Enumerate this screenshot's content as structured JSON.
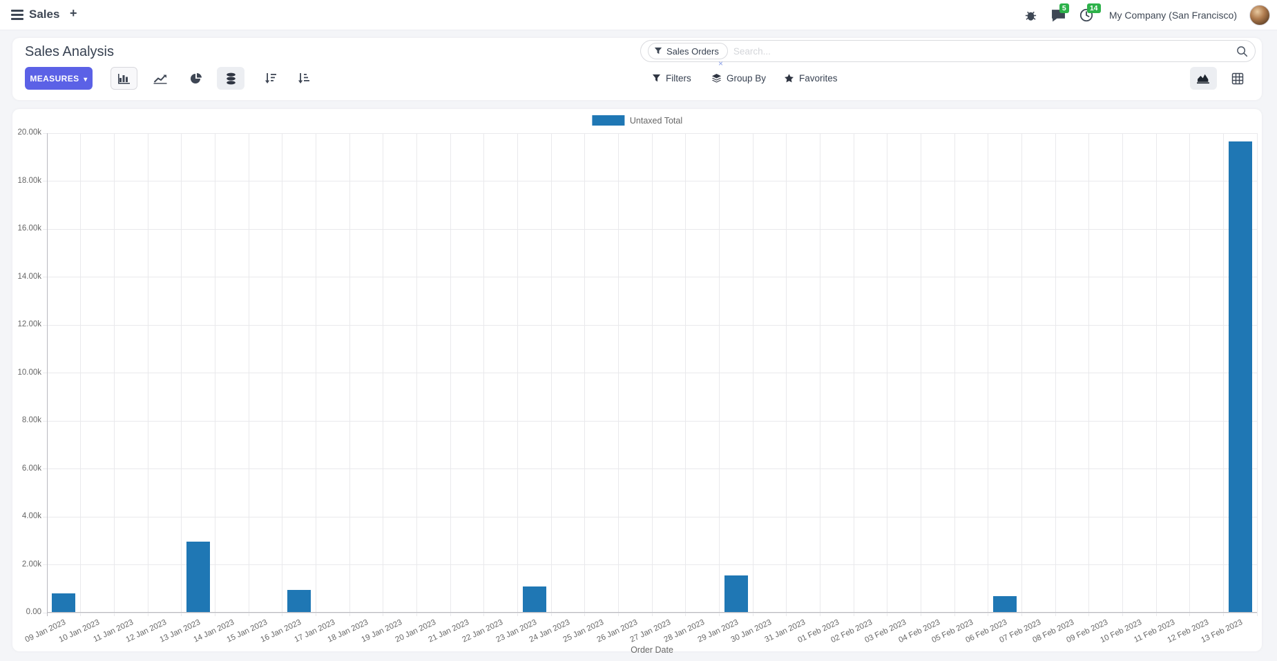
{
  "navbar": {
    "app_name": "Sales",
    "plus_label": "+",
    "messages_badge": "5",
    "activities_badge": "14",
    "company": "My Company (San Francisco)"
  },
  "control_panel": {
    "title": "Sales Analysis",
    "measures_label": "MEASURES",
    "measures_caret": "▾",
    "search": {
      "facet_label": "Sales Orders",
      "facet_remove": "×",
      "placeholder": "Search..."
    },
    "buttons": {
      "filters": "Filters",
      "group_by": "Group By",
      "favorites": "Favorites"
    }
  },
  "colors": {
    "accent": "#5b61e6",
    "badge_green": "#2db24a",
    "bar": "#1f77b4"
  },
  "chart_data": {
    "type": "bar",
    "title": "",
    "legend": [
      "Untaxed Total"
    ],
    "legend_position": "top",
    "series_color": "#1f77b4",
    "categories": [
      "09 Jan 2023",
      "10 Jan 2023",
      "11 Jan 2023",
      "12 Jan 2023",
      "13 Jan 2023",
      "14 Jan 2023",
      "15 Jan 2023",
      "16 Jan 2023",
      "17 Jan 2023",
      "18 Jan 2023",
      "19 Jan 2023",
      "20 Jan 2023",
      "21 Jan 2023",
      "22 Jan 2023",
      "23 Jan 2023",
      "24 Jan 2023",
      "25 Jan 2023",
      "26 Jan 2023",
      "27 Jan 2023",
      "28 Jan 2023",
      "29 Jan 2023",
      "30 Jan 2023",
      "31 Jan 2023",
      "01 Feb 2023",
      "02 Feb 2023",
      "03 Feb 2023",
      "04 Feb 2023",
      "05 Feb 2023",
      "06 Feb 2023",
      "07 Feb 2023",
      "08 Feb 2023",
      "09 Feb 2023",
      "10 Feb 2023",
      "11 Feb 2023",
      "12 Feb 2023",
      "13 Feb 2023"
    ],
    "values": [
      800,
      0,
      0,
      0,
      2950,
      0,
      0,
      950,
      0,
      0,
      0,
      0,
      0,
      0,
      1100,
      0,
      0,
      0,
      0,
      0,
      1550,
      0,
      0,
      0,
      0,
      0,
      0,
      0,
      680,
      0,
      0,
      0,
      0,
      0,
      0,
      19650
    ],
    "xlabel": "Order Date",
    "ylabel": "",
    "ylim": [
      0,
      20000
    ],
    "ytick_step": 2000,
    "grid": true
  }
}
